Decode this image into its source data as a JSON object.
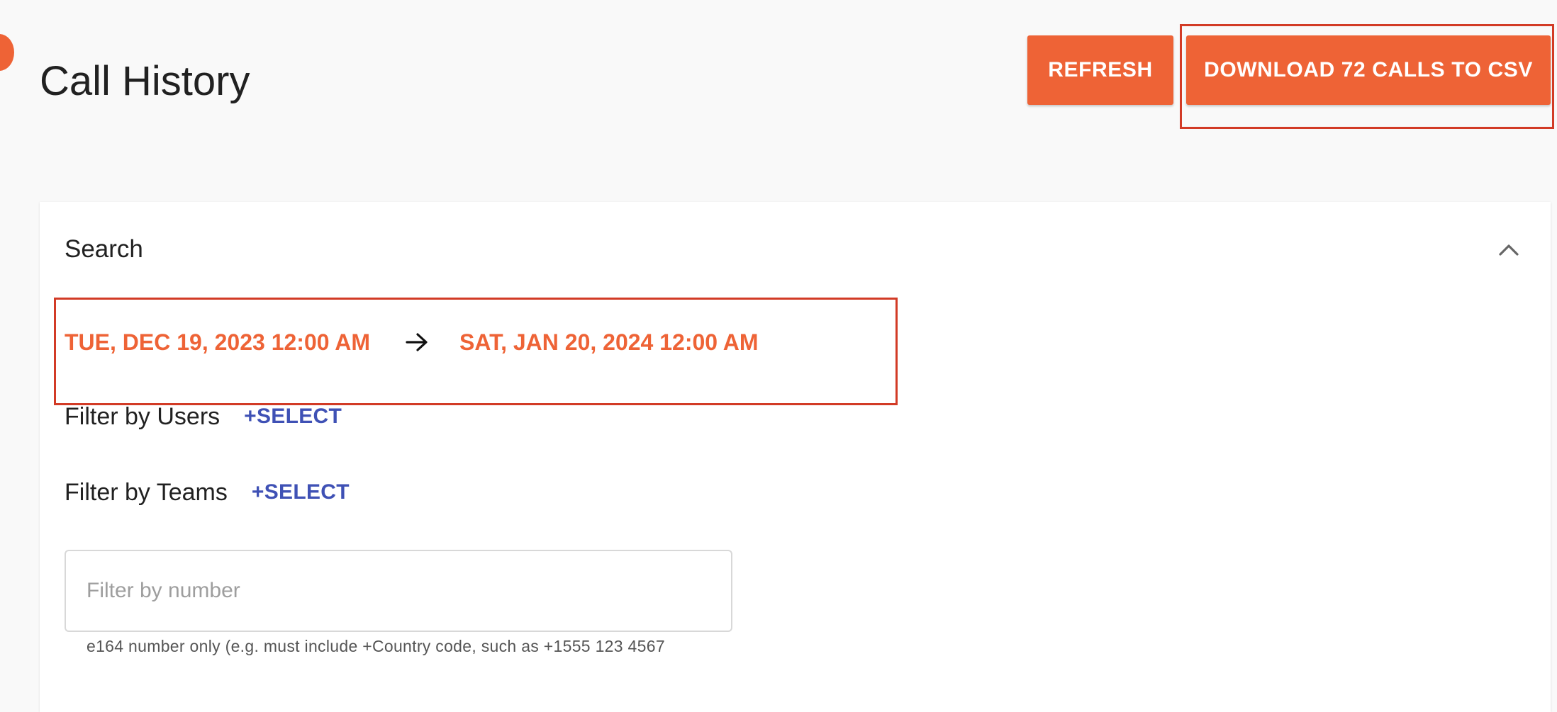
{
  "header": {
    "title": "Call History",
    "refresh_label": "REFRESH",
    "download_label": "DOWNLOAD 72 CALLS TO CSV"
  },
  "search": {
    "heading": "Search",
    "collapse_icon": "chevron-up-icon",
    "date_range": {
      "start": "TUE, DEC 19, 2023 12:00 AM",
      "end": "SAT, JAN 20, 2024 12:00 AM",
      "separator_icon": "arrow-right-icon"
    },
    "filters": [
      {
        "label": "Filter by Users",
        "action": "+SELECT"
      },
      {
        "label": "Filter by Teams",
        "action": "+SELECT"
      }
    ],
    "number_filter": {
      "value": "",
      "placeholder": "Filter by number",
      "helper": "e164 number only (e.g. must include +Country code, such as +1555 123 4567"
    }
  },
  "colors": {
    "accent": "#ee6336",
    "link": "#3f51b5",
    "annotation_box": "#d23b26",
    "page_background": "#f9f9f9"
  }
}
